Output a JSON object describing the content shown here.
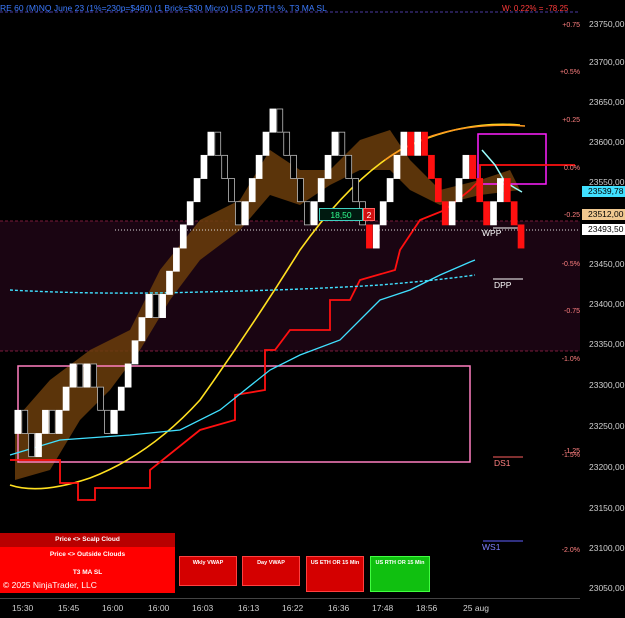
{
  "title": "RE 60 (M)NQ June 23 (1%=230p=$460) (1 Brick=$30 Micro) US Dy RTH %, T3 MA SL",
  "corner_label": "W: 0.22% = -78.25",
  "corner_button": "F",
  "price_ticks": [
    "23750,00",
    "23700,00",
    "23650,00",
    "23600,00",
    "23550,00",
    "23450,00",
    "23400,00",
    "23350,00",
    "23300,00",
    "23250,00",
    "23200,00",
    "23150,00",
    "23100,00",
    "23050,00"
  ],
  "pct_labels": [
    "+0.75",
    "+0.5%",
    "+0.25",
    "-0.25",
    "-0.5%",
    "-0.75",
    "-1.0%",
    "-1.5%",
    "-2.0%"
  ],
  "pct_mid_labels": [
    "0.0%",
    "-1.25"
  ],
  "price_flags": [
    {
      "text": "23539,78",
      "bg": "#40e0ff",
      "fg": "#000"
    },
    {
      "text": "23512,00",
      "bg": "#f0c890",
      "fg": "#000"
    },
    {
      "text": "23493,50",
      "bg": "#ffffff",
      "fg": "#000"
    }
  ],
  "time_ticks": [
    "15:30",
    "15:45",
    "16:00",
    "16:00",
    "16:03",
    "16:13",
    "16:22",
    "16:36",
    "17:48",
    "18:56",
    "25 aug"
  ],
  "levels": {
    "wpp": "WPP",
    "dpp": "DPP",
    "ds1": "DS1",
    "ws1": "WS1"
  },
  "badge": {
    "value": "18,50",
    "count": "2"
  },
  "panel": {
    "row1": "Price <> Scalp Cloud",
    "row2": "Price <> Outside Clouds",
    "row3": "T3 MA SL"
  },
  "copyright": "© 2025 NinjaTrader, LLC",
  "buttons": [
    {
      "label": "Wkly VWAP",
      "style": "red"
    },
    {
      "label": "Day VWAP",
      "style": "red"
    },
    {
      "label": "US ETH OR 15 Min",
      "style": "red"
    },
    {
      "label": "US RTH OR 15 Min",
      "style": "green"
    }
  ],
  "chart_data": {
    "type": "line",
    "instrument": "NQ June 23",
    "ylim": [
      23040,
      23770
    ],
    "bricks": [
      23240,
      23270,
      23240,
      23210,
      23240,
      23270,
      23240,
      23270,
      23300,
      23330,
      23300,
      23330,
      23300,
      23270,
      23240,
      23270,
      23300,
      23330,
      23360,
      23390,
      23420,
      23390,
      23420,
      23450,
      23480,
      23510,
      23540,
      23570,
      23600,
      23630,
      23600,
      23570,
      23540,
      23510,
      23540,
      23570,
      23600,
      23630,
      23660,
      23630,
      23600,
      23570,
      23540,
      23510,
      23540,
      23570,
      23600,
      23630,
      23600,
      23570,
      23540,
      23510,
      23480,
      23510,
      23540,
      23570,
      23600,
      23630,
      23600,
      23630,
      23600,
      23570,
      23540,
      23510,
      23540,
      23570,
      23600,
      23570,
      23540,
      23510,
      23540,
      23570,
      23540,
      23510,
      23480
    ]
  }
}
